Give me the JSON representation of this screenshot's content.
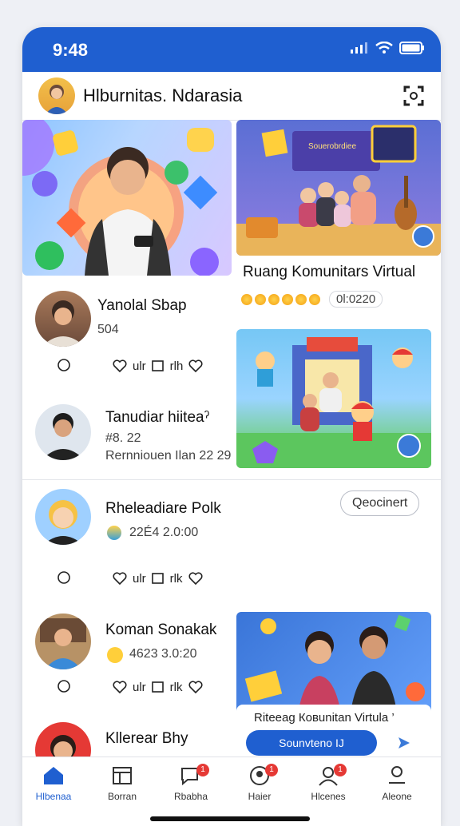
{
  "status": {
    "time": "9:48"
  },
  "header": {
    "title": "Hlburnitas. Ndarasia"
  },
  "featured": {
    "caption": "Ruang Komunitars Virtual",
    "rating_text": "0l:0220",
    "board_text": "Souerobrdiee"
  },
  "items": [
    {
      "name": "Yanolal Sbaр",
      "sub": "504",
      "actions": {
        "label1": "ulr",
        "label2": "rlh"
      }
    },
    {
      "name": "Tanudiar hiiteaˀ",
      "sub": "#8. 22",
      "sub2": "Rernniouen Ilan 22 29"
    },
    {
      "name": "Rheleadiare Polk",
      "sub": "22É4 2.0:00",
      "pill": "Qeocinert",
      "actions": {
        "label1": "ulr",
        "label2": "rlk"
      }
    },
    {
      "name": "Koman Sonakak",
      "sub": "4623 3.0:20",
      "actions": {
        "label1": "ulr",
        "label2": "rlk"
      }
    },
    {
      "name": "Kllerear Bhy",
      "sub": ""
    }
  ],
  "promo": {
    "title": "Riteeag Ковunitan Virtula ’",
    "button": "Sounvteno IJ"
  },
  "tabs": [
    {
      "label": "Hlbenaa",
      "icon": "home-icon",
      "badge": ""
    },
    {
      "label": "Borran",
      "icon": "calendar-icon",
      "badge": ""
    },
    {
      "label": "Rbabha",
      "icon": "chat-icon",
      "badge": "1"
    },
    {
      "label": "Haier",
      "icon": "people-icon",
      "badge": "1"
    },
    {
      "label": "Hlcenes",
      "icon": "profile-icon",
      "badge": "1"
    },
    {
      "label": "Aleone",
      "icon": "user-icon",
      "badge": ""
    }
  ],
  "colors": {
    "accent": "#1f5fd0",
    "badge": "#e53935"
  }
}
